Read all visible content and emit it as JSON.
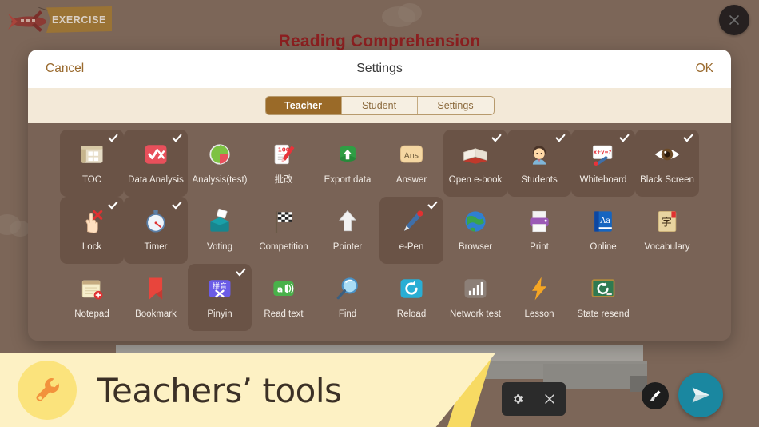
{
  "background": {
    "lesson_title": "Reading Comprehension",
    "exercise_banner": "EXERCISE",
    "close_icon": "close-icon",
    "plane_icon": "airplane-icon"
  },
  "modal": {
    "cancel_label": "Cancel",
    "title": "Settings",
    "ok_label": "OK",
    "tabs": [
      {
        "label": "Teacher",
        "active": true
      },
      {
        "label": "Student",
        "active": false
      },
      {
        "label": "Settings",
        "active": false
      }
    ],
    "tools": [
      [
        {
          "label": "TOC",
          "icon": "toc-icon",
          "selected": true
        },
        {
          "label": "Data Analysis",
          "icon": "data-analysis-icon",
          "selected": true
        },
        {
          "label": "Analysis(test)",
          "icon": "pie-chart-icon",
          "selected": false
        },
        {
          "label": "批改",
          "icon": "grading-icon",
          "selected": false
        },
        {
          "label": "Export data",
          "icon": "export-data-icon",
          "selected": false
        },
        {
          "label": "Answer",
          "icon": "answer-icon",
          "selected": false
        },
        {
          "label": "Open e-book",
          "icon": "open-book-icon",
          "selected": true
        },
        {
          "label": "Students",
          "icon": "student-icon",
          "selected": true
        },
        {
          "label": "Whiteboard",
          "icon": "whiteboard-icon",
          "selected": true
        },
        {
          "label": "Black Screen",
          "icon": "eye-icon",
          "selected": true
        }
      ],
      [
        {
          "label": "Lock",
          "icon": "lock-hand-icon",
          "selected": true
        },
        {
          "label": "Timer",
          "icon": "stopwatch-icon",
          "selected": true
        },
        {
          "label": "Voting",
          "icon": "ballot-box-icon",
          "selected": false
        },
        {
          "label": "Competition",
          "icon": "checkered-flag-icon",
          "selected": false
        },
        {
          "label": "Pointer",
          "icon": "pointer-arrow-icon",
          "selected": false
        },
        {
          "label": "e-Pen",
          "icon": "pen-icon",
          "selected": true
        },
        {
          "label": "Browser",
          "icon": "globe-icon",
          "selected": false
        },
        {
          "label": "Print",
          "icon": "printer-icon",
          "selected": false
        },
        {
          "label": "Online",
          "icon": "dictionary-icon",
          "selected": false
        },
        {
          "label": "Vocabulary",
          "icon": "vocabulary-icon",
          "selected": false
        }
      ],
      [
        {
          "label": "Notepad",
          "icon": "notepad-icon",
          "selected": false
        },
        {
          "label": "Bookmark",
          "icon": "bookmark-icon",
          "selected": false
        },
        {
          "label": "Pinyin",
          "icon": "pinyin-icon",
          "selected": true
        },
        {
          "label": "Read text",
          "icon": "read-aloud-icon",
          "selected": false
        },
        {
          "label": "Find",
          "icon": "magnifier-icon",
          "selected": false
        },
        {
          "label": "Reload",
          "icon": "reload-icon",
          "selected": false
        },
        {
          "label": "Network test",
          "icon": "signal-bars-icon",
          "selected": false
        },
        {
          "label": "Lesson",
          "icon": "lightning-icon",
          "selected": false
        },
        {
          "label": "State resend",
          "icon": "state-resend-icon",
          "selected": false
        },
        {
          "label": "",
          "icon": "",
          "selected": false
        }
      ]
    ]
  },
  "banner": {
    "title": "Teachers’ tools",
    "wrench_icon": "wrench-icon"
  },
  "bottom_controls": {
    "gear_icon": "gear-icon",
    "close_icon": "close-icon",
    "brush_icon": "brush-icon",
    "send_icon": "send-icon"
  },
  "colors": {
    "page_bg": "#7c6658",
    "modal_body": "#796356",
    "tile_selected": "#6a5346",
    "tab_active": "#9a6a28",
    "tab_bar_bg": "#f3e9d8",
    "title_red": "#8c1f20",
    "accent_ok": "#9a6a2e",
    "banner_yellow": "#fdf1c4",
    "banner_edge": "#f7da63",
    "send_teal": "#1a87a0"
  }
}
